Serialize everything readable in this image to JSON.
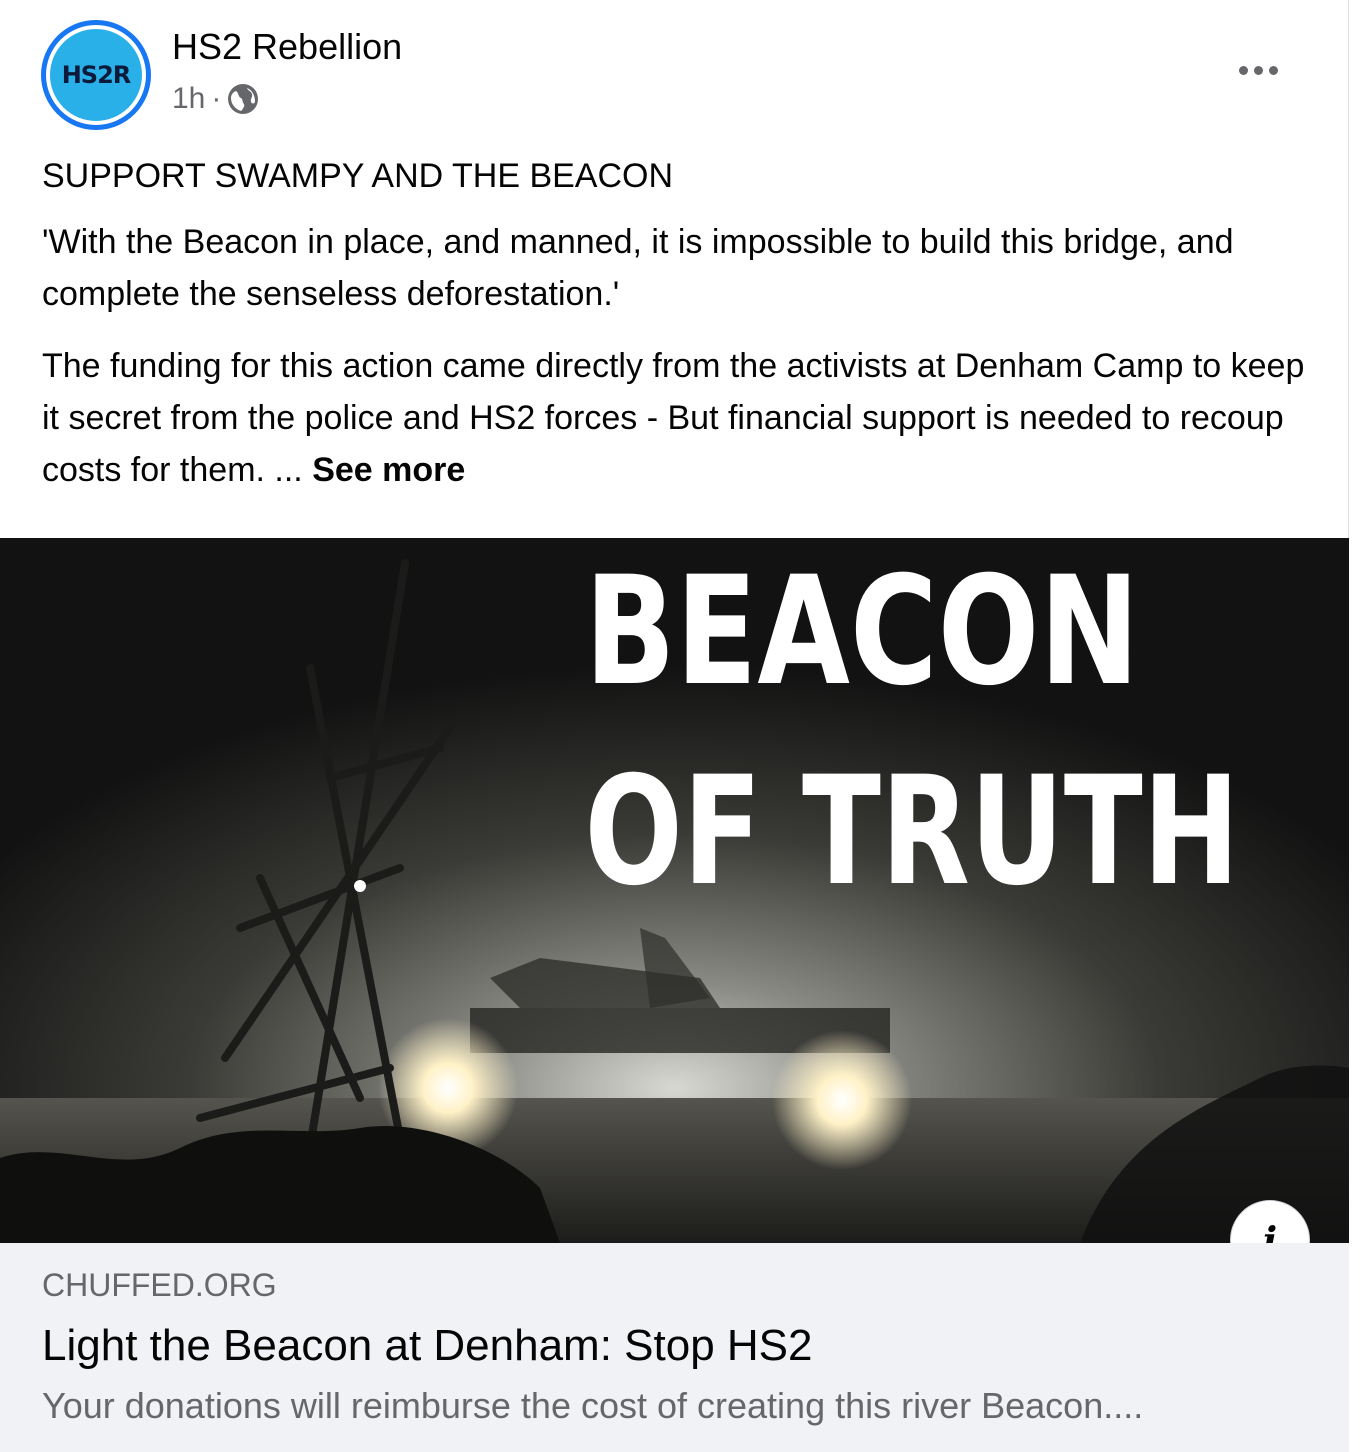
{
  "post": {
    "author": "HS2 Rebellion",
    "avatar_text": "HS2R",
    "time": "1h",
    "separator": "·",
    "privacy_icon": "globe-icon",
    "menu_icon": "more-options-icon",
    "paragraphs": [
      "SUPPORT SWAMPY AND THE BEACON",
      "'With the Beacon in place, and manned, it is impossible to build this bridge, and complete the senseless deforestation.'",
      "The funding for this action came directly from the activists at Denham Camp to keep it secret from the police and HS2 forces - But financial support is needed to recoup costs for them. ..."
    ],
    "see_more": "See more"
  },
  "image": {
    "headline_line1": "BEACON",
    "headline_line2": "OF TRUTH"
  },
  "link": {
    "domain": "CHUFFED.ORG",
    "title": "Light the Beacon at Denham: Stop HS2",
    "description": "Your donations will reimburse the cost of creating this river Beacon....",
    "info_label": "i"
  },
  "colors": {
    "brand_blue": "#1877f2",
    "secondary_text": "#65676b",
    "link_background": "#f0f2f5"
  }
}
